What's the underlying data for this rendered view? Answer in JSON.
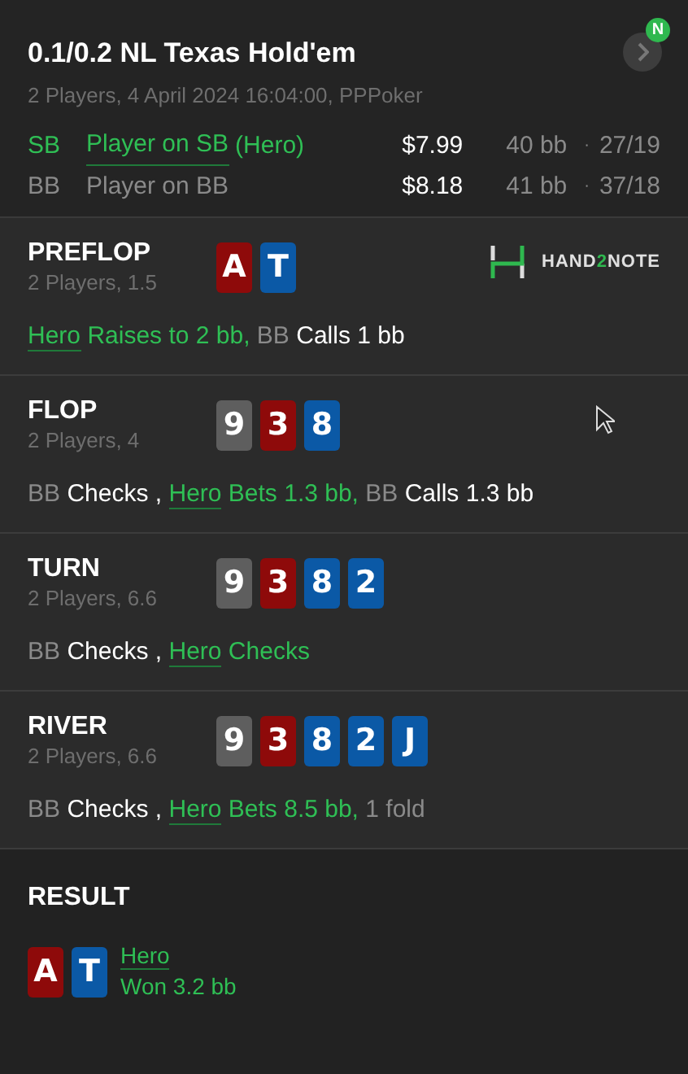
{
  "header": {
    "title": "0.1/0.2 NL Texas Hold'em",
    "subtitle": "2 Players, 4 April 2024 16:04:00, PPPoker",
    "badge": "N",
    "players": [
      {
        "position": "SB",
        "name": "Player on SB",
        "tag": "(Hero)",
        "hero": true,
        "stack": "$7.99",
        "bb": "40 bb",
        "dot": "·",
        "stats": "27/19"
      },
      {
        "position": "BB",
        "name": "Player on BB",
        "hero": false,
        "stack": "$8.18",
        "bb": "41 bb",
        "dot": "·",
        "stats": "37/18"
      }
    ]
  },
  "streets": [
    {
      "name": "PREFLOP",
      "info": "2 Players, 1.5",
      "logo": [
        "HAND",
        "2",
        "NOTE"
      ],
      "cards": [
        {
          "rank": "A",
          "color": "#8e0a0a"
        },
        {
          "rank": "T",
          "color": "#0b59a6"
        }
      ],
      "actions": [
        {
          "kind": "hero",
          "actor": "Hero",
          "text": "Raises to 2 bb,"
        },
        {
          "kind": "villain",
          "actor": "BB",
          "text": "Calls 1 bb"
        }
      ]
    },
    {
      "name": "FLOP",
      "info": "2 Players, 4",
      "cards": [
        {
          "rank": "9",
          "color": "#5e5e5e"
        },
        {
          "rank": "3",
          "color": "#8e0a0a"
        },
        {
          "rank": "8",
          "color": "#0b59a6"
        }
      ],
      "actions": [
        {
          "kind": "villain",
          "actor": "BB",
          "text": "Checks"
        },
        {
          "kind": "sep",
          "text": ","
        },
        {
          "kind": "hero",
          "actor": "Hero",
          "text": "Bets 1.3 bb,"
        },
        {
          "kind": "villain",
          "actor": "BB",
          "text": "Calls 1.3 bb"
        }
      ]
    },
    {
      "name": "TURN",
      "info": "2 Players, 6.6",
      "cards": [
        {
          "rank": "9",
          "color": "#5e5e5e"
        },
        {
          "rank": "3",
          "color": "#8e0a0a"
        },
        {
          "rank": "8",
          "color": "#0b59a6"
        },
        {
          "rank": "2",
          "color": "#0b59a6"
        }
      ],
      "actions": [
        {
          "kind": "villain",
          "actor": "BB",
          "text": "Checks"
        },
        {
          "kind": "sep",
          "text": ","
        },
        {
          "kind": "hero",
          "actor": "Hero",
          "text": "Checks"
        }
      ]
    },
    {
      "name": "RIVER",
      "info": "2 Players, 6.6",
      "cards": [
        {
          "rank": "9",
          "color": "#5e5e5e"
        },
        {
          "rank": "3",
          "color": "#8e0a0a"
        },
        {
          "rank": "8",
          "color": "#0b59a6"
        },
        {
          "rank": "2",
          "color": "#0b59a6"
        },
        {
          "rank": "J",
          "color": "#0b59a6"
        }
      ],
      "actions": [
        {
          "kind": "villain",
          "actor": "BB",
          "text": "Checks"
        },
        {
          "kind": "sep",
          "text": ","
        },
        {
          "kind": "hero",
          "actor": "Hero",
          "text": "Bets 8.5 bb,"
        },
        {
          "kind": "note",
          "text": "1 fold"
        }
      ]
    }
  ],
  "result": {
    "title": "RESULT",
    "cards": [
      {
        "rank": "A",
        "color": "#8e0a0a"
      },
      {
        "rank": "T",
        "color": "#0b59a6"
      }
    ],
    "winner": "Hero",
    "amount": "Won 3.2 bb"
  }
}
